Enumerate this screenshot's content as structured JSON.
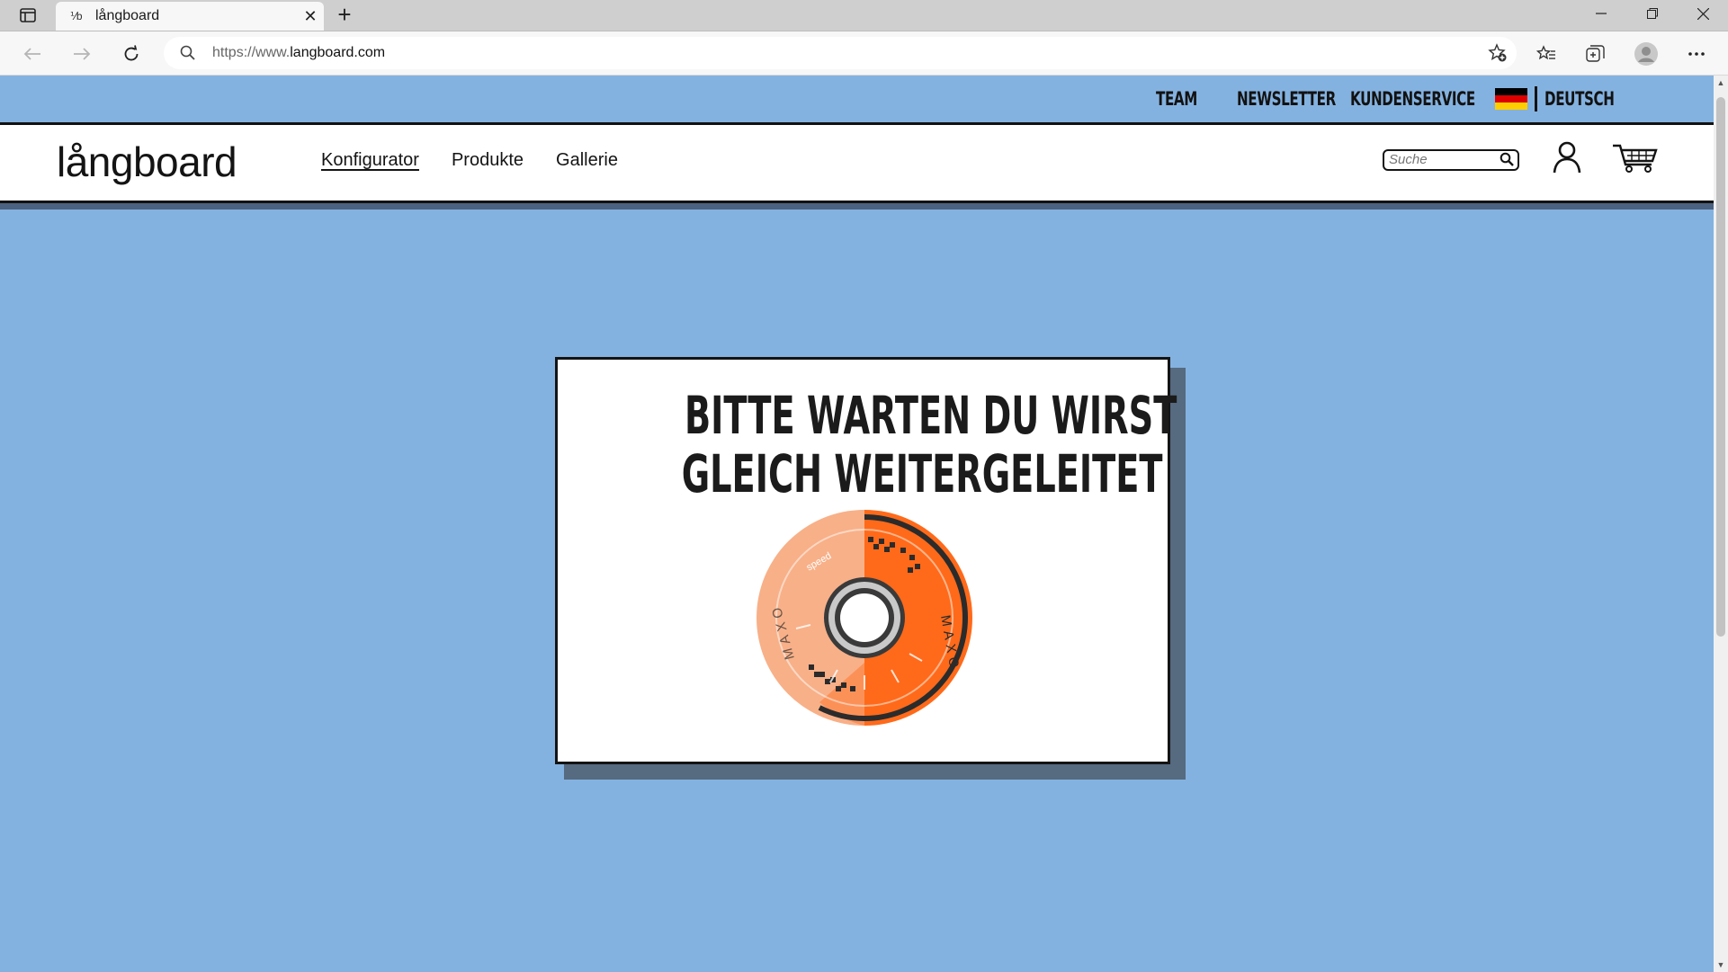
{
  "browser": {
    "tab": {
      "favicon_text": "⅟b",
      "title": "långboard",
      "close_icon": "close-icon"
    },
    "new_tab_label": "+",
    "url_prefix": "https://www.",
    "url_domain": "langboard.com",
    "window_controls": [
      "minimize-icon",
      "restore-icon",
      "close-icon"
    ],
    "toolbar_icons": [
      "favorite-add-icon",
      "favorites-icon",
      "collections-icon",
      "profile-icon",
      "more-icon"
    ]
  },
  "topnav": {
    "items": [
      "TEAM",
      "NEWSLETTER",
      "KUNDENSERVICE"
    ],
    "language": "DEUTSCH",
    "flag_colors": [
      "#000000",
      "#dd0000",
      "#ffce00"
    ]
  },
  "header": {
    "logo": "långboard",
    "nav": [
      {
        "label": "Konfigurator",
        "active": true
      },
      {
        "label": "Produkte",
        "active": false
      },
      {
        "label": "Gallerie",
        "active": false
      }
    ],
    "search_placeholder": "Suche"
  },
  "message": {
    "line1": "BITTE WARTEN DU WIRST",
    "line2": "GLEICH WEITERGELEITET"
  },
  "wheel": {
    "brand_text": "MAXO",
    "speed_text": "speed",
    "colors": {
      "primary": "#ff6a1a",
      "light": "#f8b088",
      "dark": "#2b2b2b"
    }
  },
  "colors": {
    "page_bg": "#84b2e0",
    "shadow": "#566a80",
    "ink": "#141414"
  }
}
